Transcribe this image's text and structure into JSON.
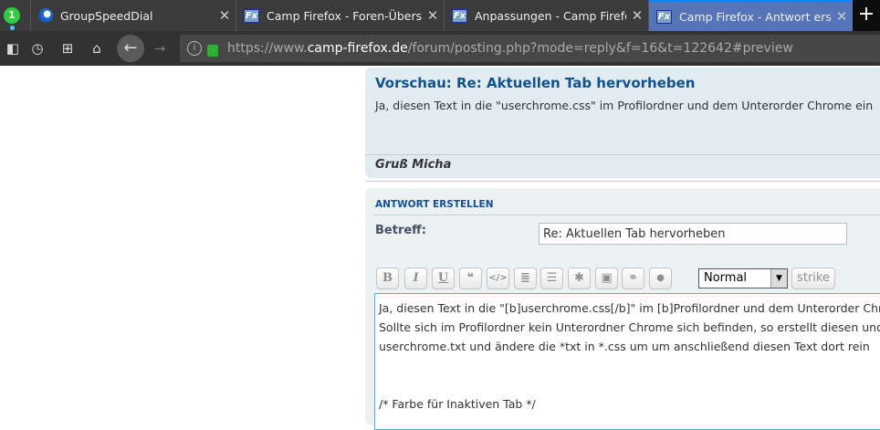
{
  "browser": {
    "notification_count": "1",
    "tabs": [
      {
        "title": "GroupSpeedDial",
        "active": false
      },
      {
        "title": "Camp Firefox - Foren-Übersicht",
        "active": false
      },
      {
        "title": "Anpassungen - Camp Firefox",
        "active": false
      },
      {
        "title": "Camp Firefox - Antwort erstellen",
        "active": true
      }
    ],
    "new_tab": "+",
    "url_prefix": "https://www.",
    "url_domain": "camp-firefox.de",
    "url_path": "/forum/posting.php?mode=reply&f=16&t=122642#preview"
  },
  "preview": {
    "title": "Vorschau: Re: Aktuellen Tab hervorheben",
    "body": "Ja, diesen Text in die \"userchrome.css\" im Profilordner und dem Unterorder Chrome ein",
    "signature": "Gruß Micha"
  },
  "reply": {
    "heading": "ANTWORT ERSTELLEN",
    "subject_label": "Betreff:",
    "subject_value": "Re: Aktuellen Tab hervorheben",
    "toolbar": {
      "bold": "B",
      "italic": "I",
      "underline": "U",
      "quote": "❝",
      "code": "</>",
      "list": "≣",
      "list_numbered": "☰",
      "list_item": "✱",
      "image": "▣",
      "link": "⚭",
      "color": "●",
      "font_size": "Normal",
      "strike": "strike"
    },
    "message_lines": [
      "Ja, diesen Text in die \"[b]userchrome.css[/b]\" im [b]Profilordner und dem Unterorder Chrome",
      "Sollte sich im Profilordner kein Unterordner Chrome sich befinden, so erstellt diesen und",
      "userchrome.txt und ändere die *txt in *.css um um anschließend diesen Text dort rein",
      "",
      "",
      "/* Farbe für Inaktiven Tab */"
    ]
  }
}
